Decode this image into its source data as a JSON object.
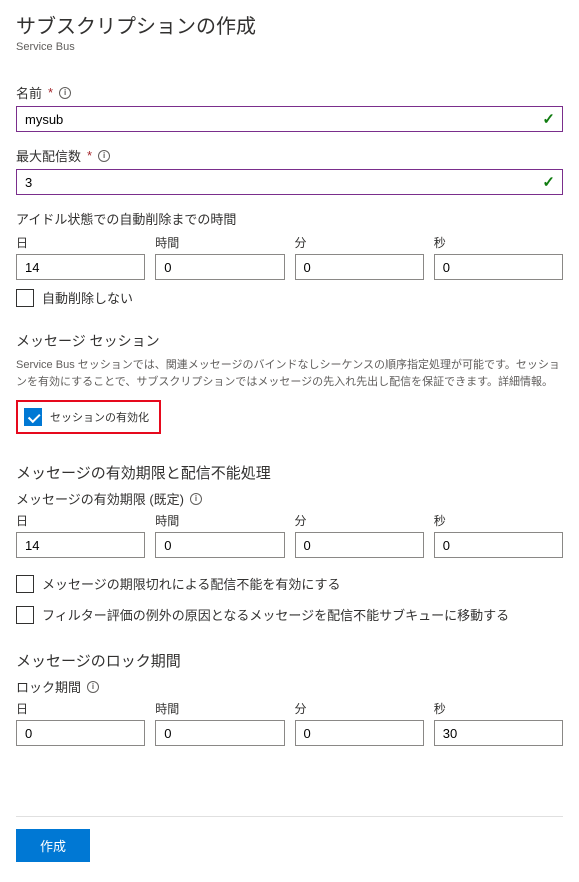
{
  "header": {
    "title": "サブスクリプションの作成",
    "subtitle": "Service Bus"
  },
  "name_field": {
    "label": "名前",
    "value": "mysub"
  },
  "max_delivery": {
    "label": "最大配信数",
    "value": "3"
  },
  "auto_delete": {
    "heading": "アイドル状態での自動削除までの時間",
    "days_label": "日",
    "days": "14",
    "hours_label": "時間",
    "hours": "0",
    "minutes_label": "分",
    "minutes": "0",
    "seconds_label": "秒",
    "seconds": "0",
    "no_auto_delete": "自動削除しない"
  },
  "sessions": {
    "heading": "メッセージ セッション",
    "desc": "Service Bus セッションでは、関連メッセージのバインドなしシーケンスの順序指定処理が可能です。セッションを有効にすることで、サブスクリプションではメッセージの先入れ先出し配信を保証できます。詳細情報。",
    "enable_label": "セッションの有効化"
  },
  "ttl": {
    "heading": "メッセージの有効期限と配信不能処理",
    "subheading": "メッセージの有効期限 (既定)",
    "days_label": "日",
    "days": "14",
    "hours_label": "時間",
    "hours": "0",
    "minutes_label": "分",
    "minutes": "0",
    "seconds_label": "秒",
    "seconds": "0",
    "dead_letter_expire": "メッセージの期限切れによる配信不能を有効にする",
    "dead_letter_filter": "フィルター評価の例外の原因となるメッセージを配信不能サブキューに移動する"
  },
  "lock": {
    "heading": "メッセージのロック期間",
    "subheading": "ロック期間",
    "days_label": "日",
    "days": "0",
    "hours_label": "時間",
    "hours": "0",
    "minutes_label": "分",
    "minutes": "0",
    "seconds_label": "秒",
    "seconds": "30"
  },
  "footer": {
    "create": "作成"
  }
}
